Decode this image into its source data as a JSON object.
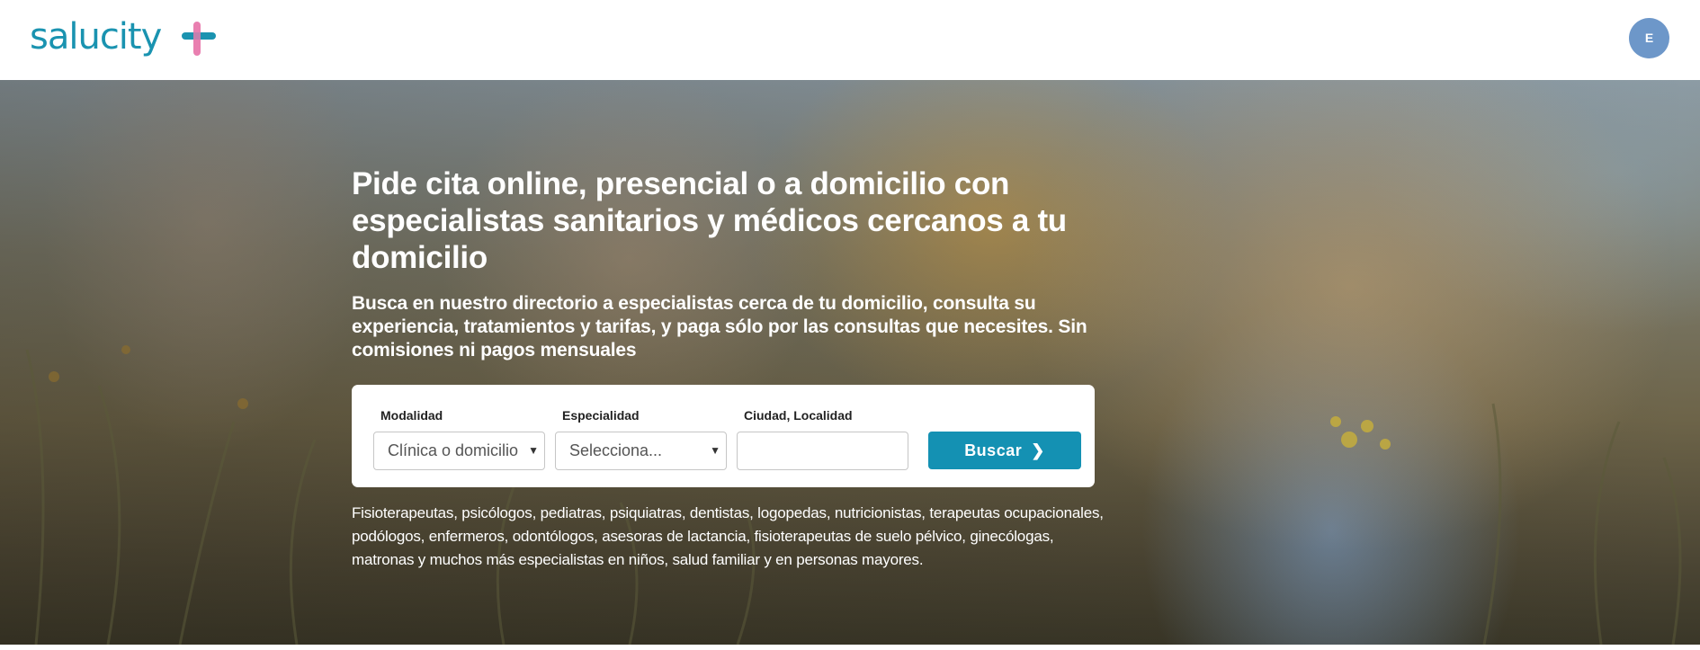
{
  "header": {
    "logo_text": "salucity",
    "logo_icon": "plus-cross-icon",
    "avatar_initial": "E"
  },
  "hero": {
    "title": "Pide cita online, presencial o a domicilio con especialistas sanitarios y médicos cercanos a tu domicilio",
    "subtitle": "Busca en nuestro directorio a especialistas cerca de tu domicilio, consulta su experiencia, tratamientos y tarifas, y paga sólo por las consultas que necesites. Sin comisiones ni pagos mensuales",
    "specialties_text": "Fisioterapeutas, psicólogos, pediatras, psiquiatras, dentistas, logopedas, nutricionistas, terapeutas ocupacionales, podólogos, enfermeros, odontólogos, asesoras de lactancia, fisioterapeutas de suelo pélvico, ginecólogas, matronas y muchos más especialistas en niños, salud familiar y en personas mayores."
  },
  "search": {
    "modalidad_label": "Modalidad",
    "modalidad_value": "Clínica o domicilio",
    "especialidad_label": "Especialidad",
    "especialidad_value": "Selecciona...",
    "ciudad_label": "Ciudad, Localidad",
    "ciudad_value": "",
    "button_label": "Buscar",
    "button_icon": "chevron-right-icon"
  },
  "colors": {
    "brand_teal": "#1a93b0",
    "brand_pink": "#e97fb0",
    "button_bg": "#1491b3",
    "avatar_bg": "#6d97c9"
  }
}
